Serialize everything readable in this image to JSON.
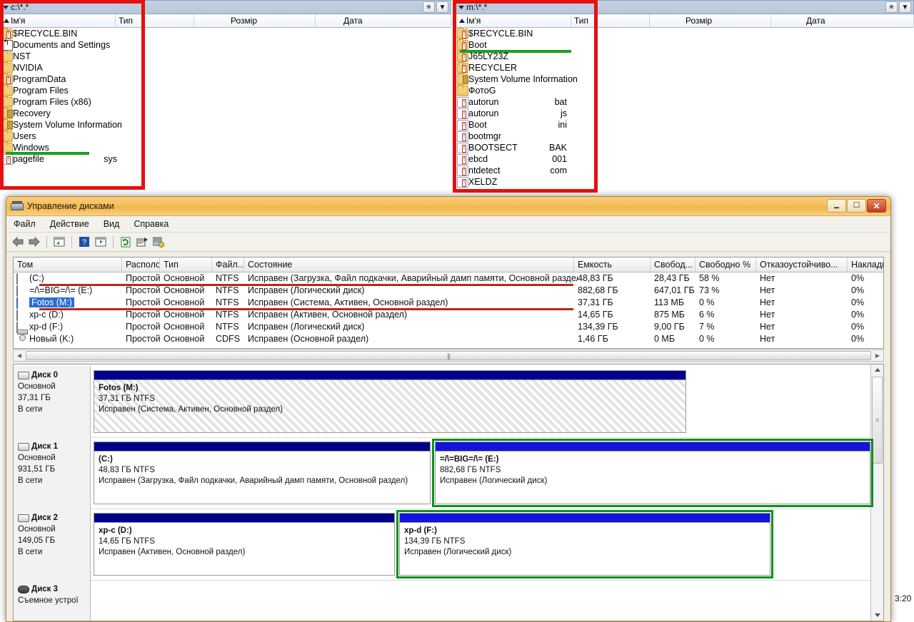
{
  "file_manager": {
    "left_panel": {
      "path": "c:\\*.*",
      "columns": [
        {
          "label": "Ім'я",
          "sorted": true
        },
        {
          "label": "Тип"
        },
        {
          "label": "Розмір"
        },
        {
          "label": "Дата"
        }
      ],
      "buttons": [
        {
          "name": "star-button",
          "glyph": "✳"
        },
        {
          "name": "dropdown-button",
          "glyph": "▼"
        }
      ],
      "items": [
        {
          "name": "$RECYCLE.BIN",
          "ext": "",
          "icon": "folder-bang-icon"
        },
        {
          "name": "Documents and Settings",
          "ext": "",
          "icon": "shortcut-folder-icon"
        },
        {
          "name": "NST",
          "ext": "",
          "icon": "folder-icon"
        },
        {
          "name": "NVIDIA",
          "ext": "",
          "icon": "folder-icon"
        },
        {
          "name": "ProgramData",
          "ext": "",
          "icon": "folder-bang-icon"
        },
        {
          "name": "Program Files",
          "ext": "",
          "icon": "folder-icon"
        },
        {
          "name": "Program Files (x86)",
          "ext": "",
          "icon": "folder-icon"
        },
        {
          "name": "Recovery",
          "ext": "",
          "icon": "folder-lock-icon"
        },
        {
          "name": "System Volume Information",
          "ext": "",
          "icon": "folder-lock-icon"
        },
        {
          "name": "Users",
          "ext": "",
          "icon": "folder-icon"
        },
        {
          "name": "Windows",
          "ext": "",
          "icon": "folder-icon"
        },
        {
          "name": "pagefile",
          "ext": "sys",
          "icon": "file-bang-icon"
        }
      ]
    },
    "right_panel": {
      "path": "m:\\*.*",
      "columns": [
        {
          "label": "Ім'я",
          "sorted": true
        },
        {
          "label": "Тип"
        },
        {
          "label": "Розмір"
        },
        {
          "label": "Дата"
        }
      ],
      "buttons": [
        {
          "name": "star-button",
          "glyph": "✳"
        },
        {
          "name": "dropdown-button",
          "glyph": "▼"
        }
      ],
      "items": [
        {
          "name": "$RECYCLE.BIN",
          "ext": "",
          "icon": "folder-bang-icon"
        },
        {
          "name": "Boot",
          "ext": "",
          "icon": "folder-bang-icon"
        },
        {
          "name": "J65LY23Z",
          "ext": "",
          "icon": "folder-bang-icon"
        },
        {
          "name": "RECYCLER",
          "ext": "",
          "icon": "folder-bang-icon"
        },
        {
          "name": "System Volume Information",
          "ext": "",
          "icon": "folder-lock-icon"
        },
        {
          "name": "ФотоG",
          "ext": "",
          "icon": "folder-icon"
        },
        {
          "name": "autorun",
          "ext": "bat",
          "icon": "file-bang-icon"
        },
        {
          "name": "autorun",
          "ext": "js",
          "icon": "file-bang-icon"
        },
        {
          "name": "Boot",
          "ext": "ini",
          "icon": "file-bang-icon"
        },
        {
          "name": "bootmgr",
          "ext": "",
          "icon": "file-bang-icon"
        },
        {
          "name": "BOOTSECT",
          "ext": "BAK",
          "icon": "file-bang-icon"
        },
        {
          "name": "ebcd",
          "ext": "001",
          "icon": "file-bang-icon"
        },
        {
          "name": "ntdetect",
          "ext": "com",
          "icon": "file-bang-icon"
        },
        {
          "name": "XELDZ",
          "ext": "",
          "icon": "file-bang-icon"
        }
      ]
    }
  },
  "disk_management": {
    "title": "Управление дисками",
    "window_buttons": {
      "minimize": "—",
      "maximize": "□",
      "close": "✕"
    },
    "menu": [
      "Файл",
      "Действие",
      "Вид",
      "Справка"
    ],
    "toolbar_icons": [
      "back-arrow-icon",
      "forward-arrow-icon",
      "up-one-level-icon",
      "help-icon",
      "show-console-tree-icon",
      "refresh-icon",
      "properties-icon",
      "rescan-disks-icon"
    ],
    "volume_table": {
      "columns": [
        "Том",
        "Располо...",
        "Тип",
        "Файл...",
        "Состояние",
        "Емкость",
        "Свобод...",
        "Свободно %",
        "Отказоустойчиво...",
        "Накладнь"
      ],
      "rows": [
        {
          "volume": "(C:)",
          "icon": "hard-drive-icon",
          "selected": false,
          "layout": "Простой",
          "type": "Основной",
          "fs": "NTFS",
          "status": "Исправен (Загрузка, Файл подкачки, Аварийный дамп памяти, Основной раздел)",
          "capacity": "48,83 ГБ",
          "free": "28,43 ГБ",
          "free_pct": "58 %",
          "fault_tolerance": "Нет",
          "overhead": "0%"
        },
        {
          "volume": "=/\\=BIG=/\\= (E:)",
          "icon": "hard-drive-icon",
          "selected": false,
          "layout": "Простой",
          "type": "Основной",
          "fs": "NTFS",
          "status": "Исправен (Логический диск)",
          "capacity": "882,68 ГБ",
          "free": "647,01 ГБ",
          "free_pct": "73 %",
          "fault_tolerance": "Нет",
          "overhead": "0%"
        },
        {
          "volume": "Fotos (M:)",
          "icon": "hard-drive-icon-blue",
          "selected": true,
          "layout": "Простой",
          "type": "Основной",
          "fs": "NTFS",
          "status": "Исправен (Система, Активен, Основной раздел)",
          "capacity": "37,31 ГБ",
          "free": "113 МБ",
          "free_pct": "0 %",
          "fault_tolerance": "Нет",
          "overhead": "0%"
        },
        {
          "volume": "xp-c (D:)",
          "icon": "hard-drive-icon",
          "selected": false,
          "layout": "Простой",
          "type": "Основной",
          "fs": "NTFS",
          "status": "Исправен (Активен, Основной раздел)",
          "capacity": "14,65 ГБ",
          "free": "875 МБ",
          "free_pct": "6 %",
          "fault_tolerance": "Нет",
          "overhead": "0%"
        },
        {
          "volume": "xp-d (F:)",
          "icon": "hard-drive-icon",
          "selected": false,
          "layout": "Простой",
          "type": "Основной",
          "fs": "NTFS",
          "status": "Исправен (Логический диск)",
          "capacity": "134,39 ГБ",
          "free": "9,00 ГБ",
          "free_pct": "7 %",
          "fault_tolerance": "Нет",
          "overhead": "0%"
        },
        {
          "volume": "Новый (K:)",
          "icon": "cd-drive-icon",
          "selected": false,
          "layout": "Простой",
          "type": "Основной",
          "fs": "CDFS",
          "status": "Исправен (Основной раздел)",
          "capacity": "1,46 ГБ",
          "free": "0 МБ",
          "free_pct": "0 %",
          "fault_tolerance": "Нет",
          "overhead": "0%"
        }
      ]
    },
    "graphical_view": {
      "disks": [
        {
          "name": "Диск 0",
          "type": "Основной",
          "size": "37,31 ГБ",
          "status": "В сети",
          "icon": "disk-icon",
          "partitions": [
            {
              "label": "Fotos  (M:)",
              "size": "37,31 ГБ NTFS",
              "status": "Исправен (Система, Активен, Основной раздел)",
              "hatched": true,
              "highlight": false,
              "bar": "dark"
            }
          ]
        },
        {
          "name": "Диск 1",
          "type": "Основной",
          "size": "931,51 ГБ",
          "status": "В сети",
          "icon": "disk-icon",
          "partitions": [
            {
              "label": "(C:)",
              "size": "48,83 ГБ NTFS",
              "status": "Исправен (Загрузка, Файл подкачки, Аварийный дамп памяти, Основной раздел)",
              "hatched": false,
              "highlight": false,
              "bar": "dark"
            },
            {
              "label": "=/\\=BIG=/\\=  (E:)",
              "size": "882,68 ГБ NTFS",
              "status": "Исправен (Логический диск)",
              "hatched": false,
              "highlight": true,
              "bar": "bright"
            }
          ]
        },
        {
          "name": "Диск 2",
          "type": "Основной",
          "size": "149,05 ГБ",
          "status": "В сети",
          "icon": "disk-icon",
          "partitions": [
            {
              "label": "xp-c  (D:)",
              "size": "14,65 ГБ NTFS",
              "status": "Исправен (Активен, Основной раздел)",
              "hatched": false,
              "highlight": false,
              "bar": "dark"
            },
            {
              "label": "xp-d  (F:)",
              "size": "134,39 ГБ NTFS",
              "status": "Исправен (Логический диск)",
              "hatched": false,
              "highlight": true,
              "bar": "bright"
            }
          ]
        },
        {
          "name": "Диск 3",
          "type": "Съемное устрої",
          "size": "",
          "status": "",
          "icon": "removable-disk-icon",
          "partitions": []
        }
      ]
    }
  },
  "desktop": {
    "clock": "3:20"
  }
}
